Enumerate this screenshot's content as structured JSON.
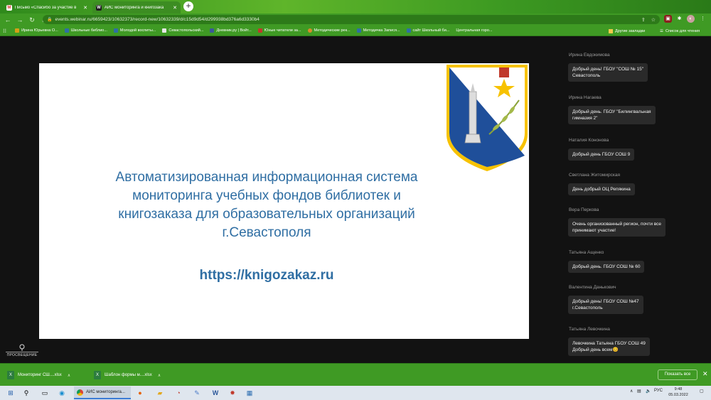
{
  "tabs": [
    {
      "label": "Письмо «Спасибо за участие в",
      "icon": "gmail-icon"
    },
    {
      "label": "АИС мониторинга и книгозака",
      "icon": "webinar-icon"
    }
  ],
  "address": {
    "url": "events.webinar.ru/6659423/10632373/record-new/10632339/d/c15d9d54/d299938bd376a6d3330b4"
  },
  "bookmarks": [
    "Ирина Юрьевна О...",
    "Школьные библио...",
    "Молодой воспиты...",
    "Севастопольский...",
    "Дневник.ру | Войт...",
    "Юные читатели за...",
    "Методические рек...",
    "Методичка Запися...",
    "сайт Школьный би...",
    "Центральная горо..."
  ],
  "bookmarks_other": "Другие закладки",
  "bookmarks_reading": "Список для чтения",
  "slide": {
    "title_lines": [
      "Автоматизированная информационная  система",
      "мониторинга учебных фондов библиотек  и",
      "книгозаказа для образовательных организаций",
      "г.Севастополя"
    ],
    "link": "https://knigozakaz.ru"
  },
  "brand": {
    "name": "ПРОСВЕЩЕНИЕ"
  },
  "chat": [
    {
      "author": "Ирина Евдокимова",
      "text_lines": [
        "Добрый день! ГБОУ \"СОШ № 15\"",
        "Севастополь"
      ]
    },
    {
      "author": "Ирина Нагаева",
      "text_lines": [
        "Добрый день. ГБОУ \"Билингвальная",
        "гимназия 2\""
      ]
    },
    {
      "author": "Наталия Кононова",
      "text_lines": [
        "Добрый день ГБОУ СОШ 9"
      ]
    },
    {
      "author": "Светлана Житомирская",
      "text_lines": [
        "День добрый ОЦ Репякина"
      ]
    },
    {
      "author": "Вера Перкова",
      "text_lines": [
        "Очень организованный регион, почти все",
        "принимают участие!"
      ]
    },
    {
      "author": "Татьяна Ащенко",
      "text_lines": [
        "Добрый день. ГБОУ СОШ № 60"
      ]
    },
    {
      "author": "Валентина Данькович",
      "text_lines": [
        "Добрый день! ГБОУ СОШ №47",
        "г.Севастополь"
      ]
    },
    {
      "author": "Татьяна Левочкина",
      "text_lines": [
        "Левочкина  Татьяна  ГБОУ  СОШ  49",
        "Добрый  день  всем😊"
      ]
    }
  ],
  "downloads": [
    {
      "name": "Мониторинг СШ....xlsx"
    },
    {
      "name": "Шаблон формы м....xlsx"
    }
  ],
  "downloads_show_all": "Показать все",
  "taskbar": {
    "active_app": "АИС мониторинга...",
    "lang": "РУС",
    "time": "9:48",
    "date": "05.03.2022"
  }
}
